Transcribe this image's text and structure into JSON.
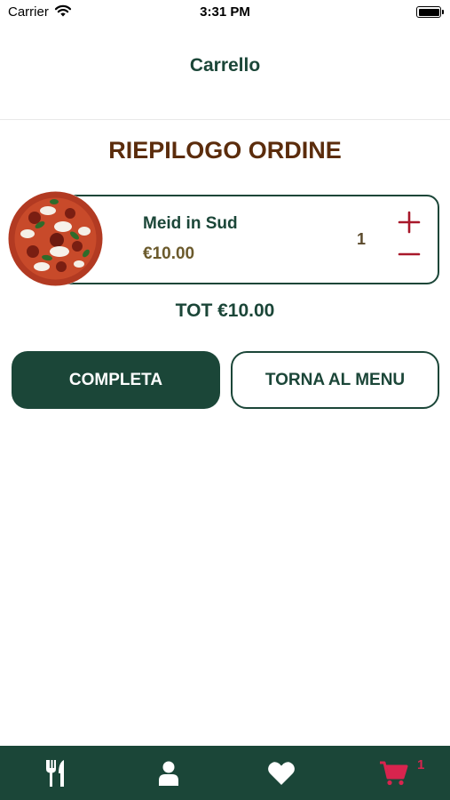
{
  "status_bar": {
    "carrier": "Carrier",
    "time": "3:31 PM"
  },
  "nav": {
    "title": "Carrello"
  },
  "summary": {
    "title": "RIEPILOGO ORDINE"
  },
  "cart_items": [
    {
      "name": "Meid in Sud",
      "price": "€10.00",
      "quantity": "1",
      "image_icon": "pizza-icon"
    }
  ],
  "total": {
    "label": "TOT €10.00"
  },
  "actions": {
    "complete_label": "COMPLETA",
    "back_label": "TORNA AL MENU"
  },
  "tab_bar": {
    "items": [
      {
        "icon": "fork-knife-icon"
      },
      {
        "icon": "user-icon"
      },
      {
        "icon": "heart-icon"
      },
      {
        "icon": "cart-icon"
      }
    ],
    "cart_badge": "1"
  },
  "colors": {
    "primary": "#1b4638",
    "title_brown": "#5b2c0c",
    "price": "#6b5a2c",
    "qty_control": "#a8182a",
    "cart_active": "#d8244e"
  }
}
